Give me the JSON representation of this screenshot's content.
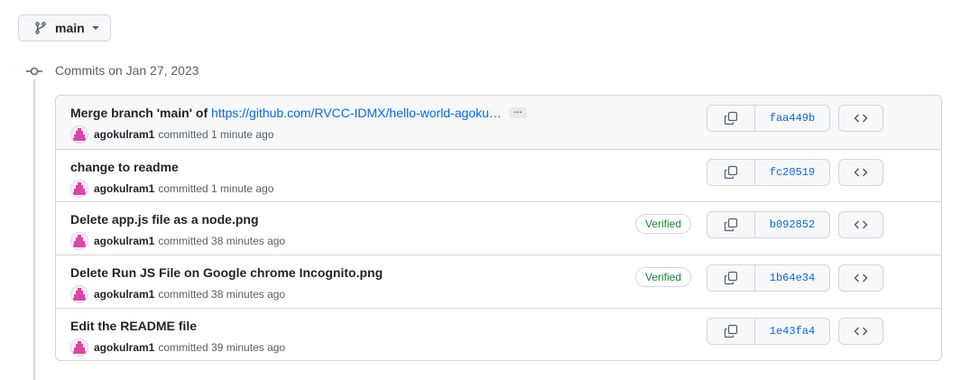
{
  "branch": {
    "name": "main",
    "icon": "git-branch-icon"
  },
  "group": {
    "title": "Commits on Jan 27, 2023"
  },
  "commits": [
    {
      "message": "Merge branch 'main' of ",
      "link": "https://github.com/RVCC-IDMX/hello-world-agoku…",
      "ellipsis": "…",
      "author": "agokulram1",
      "action": "committed 1 minute ago",
      "verified": "",
      "sha": "faa449b"
    },
    {
      "message": "change to readme",
      "link": "",
      "ellipsis": "",
      "author": "agokulram1",
      "action": "committed 1 minute ago",
      "verified": "",
      "sha": "fc20519"
    },
    {
      "message": "Delete app.js file as a node.png",
      "link": "",
      "ellipsis": "",
      "author": "agokulram1",
      "action": "committed 38 minutes ago",
      "verified": "Verified",
      "sha": "b092852"
    },
    {
      "message": "Delete Run JS File on Google chrome Incognito.png",
      "link": "",
      "ellipsis": "",
      "author": "agokulram1",
      "action": "committed 38 minutes ago",
      "verified": "Verified",
      "sha": "1b64e34"
    },
    {
      "message": "Edit the README file",
      "link": "",
      "ellipsis": "",
      "author": "agokulram1",
      "action": "committed 39 minutes ago",
      "verified": "",
      "sha": "1e43fa4"
    }
  ],
  "colors": {
    "link": "#0969da",
    "verified": "#1a7f37",
    "border": "#d0d7de",
    "avatar": "#d946a8"
  }
}
